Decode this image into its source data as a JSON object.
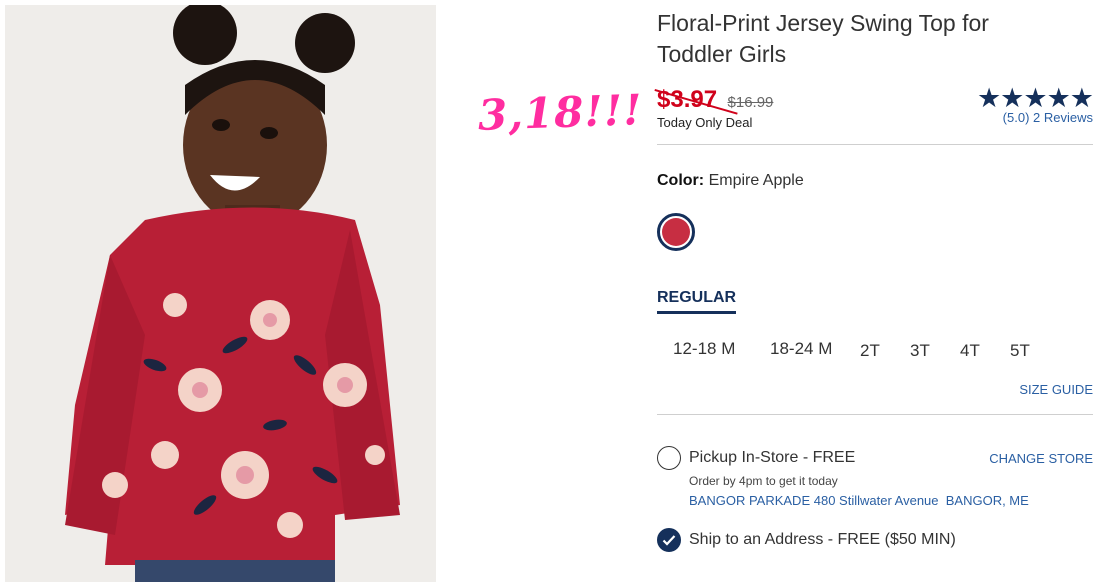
{
  "annotation": {
    "handwritten_price": "3,18!!!"
  },
  "product": {
    "title": "Floral-Print Jersey Swing Top for Toddler Girls",
    "sale_price": "$3.97",
    "original_price": "$16.99",
    "deal_label": "Today Only Deal",
    "rating": {
      "stars": "★★★★★",
      "score": "(5.0)",
      "reviews": "2 Reviews",
      "value": 5.0
    },
    "color": {
      "label": "Color:",
      "name": "Empire Apple"
    },
    "fit_tab": "REGULAR",
    "sizes": [
      "12-18 M",
      "18-24 M",
      "2T",
      "3T",
      "4T",
      "5T"
    ],
    "size_guide": "SIZE GUIDE"
  },
  "fulfillment": {
    "pickup": {
      "label": "Pickup In-Store - FREE",
      "order_by": "Order by 4pm to get it today",
      "store": "BANGOR PARKADE 480 Stillwater Avenue  BANGOR, ME",
      "change_store": "CHANGE STORE",
      "selected": false
    },
    "ship": {
      "label": "Ship to an Address - FREE ($50 MIN)",
      "selected": true
    }
  },
  "colors": {
    "navy": "#15305b",
    "sale_red": "#d0021b",
    "link_blue": "#2a5fa3",
    "annotation_pink": "#ff2da0",
    "swatch": "#c72e42"
  }
}
